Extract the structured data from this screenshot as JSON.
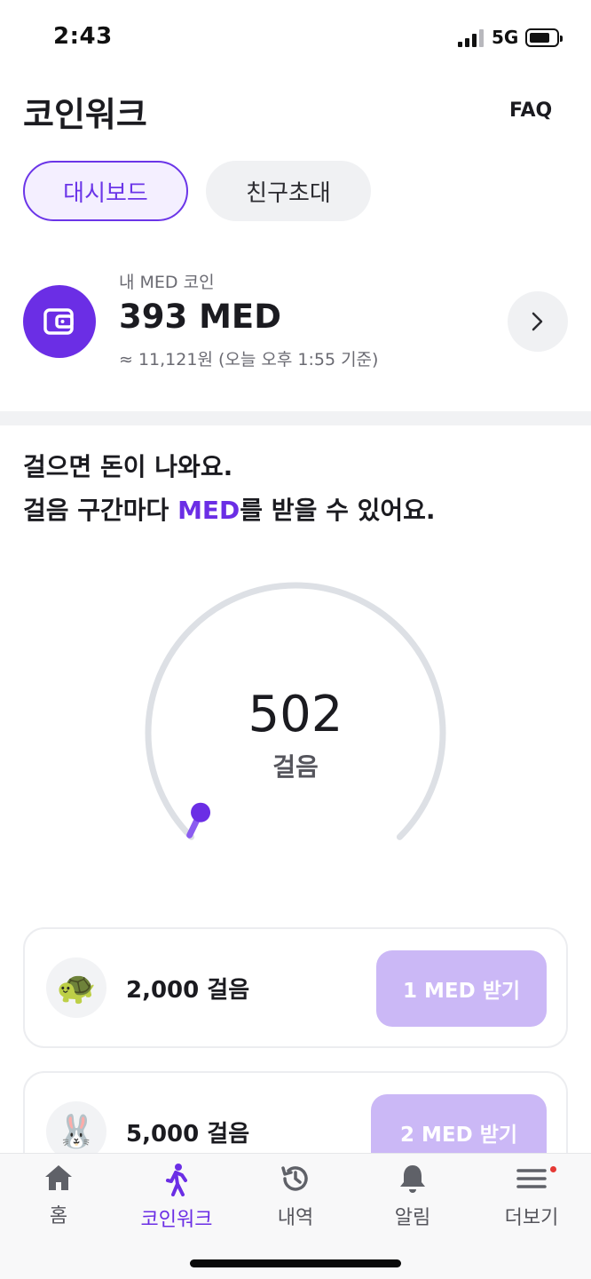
{
  "status": {
    "time": "2:43",
    "network": "5G"
  },
  "header": {
    "title": "코인워크",
    "faq": "FAQ"
  },
  "tabs": [
    {
      "label": "대시보드"
    },
    {
      "label": "친구초대"
    }
  ],
  "coin": {
    "label": "내 MED 코인",
    "amount": "393 MED",
    "sub": "≈ 11,121원 (오늘 오후 1:55 기준)"
  },
  "headline": {
    "line1": "걸으면 돈이 나와요.",
    "line2_prefix": "걸음 구간마다 ",
    "line2_accent": "MED",
    "line2_suffix": "를 받을 수 있어요."
  },
  "steps": {
    "value": "502",
    "unit": "걸음",
    "progress_fraction": 0.0251
  },
  "rewards": [
    {
      "icon": "turtle-icon",
      "emoji": "🐢",
      "steps": "2,000 걸음",
      "button": "1 MED 받기"
    },
    {
      "icon": "rabbit-icon",
      "emoji": "🐰",
      "steps": "5,000 걸음",
      "button": "2 MED 받기"
    }
  ],
  "tabbar": [
    {
      "label": "홈",
      "icon": "home-icon"
    },
    {
      "label": "코인워크",
      "icon": "walking-icon"
    },
    {
      "label": "내역",
      "icon": "history-icon"
    },
    {
      "label": "알림",
      "icon": "bell-icon"
    },
    {
      "label": "더보기",
      "icon": "menu-icon"
    }
  ],
  "colors": {
    "accent": "#6B2EE5",
    "button_disabled": "#CBB8F6",
    "gauge_track": "#DDE0E5"
  }
}
